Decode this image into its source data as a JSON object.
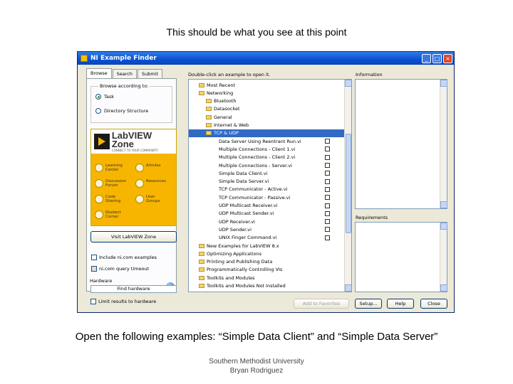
{
  "slide": {
    "title": "This should be what you see at this point",
    "caption": "Open the following examples: “Simple Data Client” and “Simple Data Server”",
    "footer_line1": "Southern Methodist University",
    "footer_line2": "Bryan Rodriguez"
  },
  "window": {
    "title": "NI Example Finder",
    "controls": {
      "minimize": "_",
      "maximize": "□",
      "close": "×"
    }
  },
  "left": {
    "tabs": [
      "Browse",
      "Search",
      "Submit"
    ],
    "browse_label": "Browse according to:",
    "radio_task": "Task",
    "radio_directory": "Directory Structure",
    "zone": {
      "brand": "LabVIEW Zone",
      "tagline": "CONNECT TO YOUR COMMUNITY",
      "items": [
        "Learning Center",
        "Articles",
        "Discussion Forum",
        "Resources",
        "Code Sharing",
        "User Groups",
        "Student Corner"
      ]
    },
    "visit_button": "Visit LabVIEW Zone",
    "include_examples": "Include ni.com examples",
    "query_timeout": "ni.com query timeout",
    "hardware_label": "Hardware",
    "find_hardware": "Find hardware",
    "limit_results": "Limit results to hardware"
  },
  "middle": {
    "label": "Double-click an example to open it.",
    "rows": [
      {
        "text": "Most Recent",
        "indent": 1,
        "icon": "folder"
      },
      {
        "text": "Networking",
        "indent": 1,
        "icon": "folder"
      },
      {
        "text": "Bluetooth",
        "indent": 2,
        "icon": "folder"
      },
      {
        "text": "Datasocket",
        "indent": 2,
        "icon": "folder"
      },
      {
        "text": "General",
        "indent": 2,
        "icon": "folder"
      },
      {
        "text": "Internet & Web",
        "indent": 2,
        "icon": "folder"
      },
      {
        "text": "TCP & UDP",
        "indent": 2,
        "icon": "folder",
        "selected": true
      },
      {
        "text": "Data Server Using Reentrant Run.vi",
        "indent": 3,
        "icon": "vi"
      },
      {
        "text": "Multiple Connections - Client 1.vi",
        "indent": 3,
        "icon": "vi"
      },
      {
        "text": "Multiple Connections - Client 2.vi",
        "indent": 3,
        "icon": "vi"
      },
      {
        "text": "Multiple Connections - Server.vi",
        "indent": 3,
        "icon": "vi"
      },
      {
        "text": "Simple Data Client.vi",
        "indent": 3,
        "icon": "vi"
      },
      {
        "text": "Simple Data Server.vi",
        "indent": 3,
        "icon": "vi"
      },
      {
        "text": "TCP Communicator - Active.vi",
        "indent": 3,
        "icon": "vi"
      },
      {
        "text": "TCP Communicator - Passive.vi",
        "indent": 3,
        "icon": "vi"
      },
      {
        "text": "UDP Multicast Receiver.vi",
        "indent": 3,
        "icon": "vi"
      },
      {
        "text": "UDP Multicast Sender.vi",
        "indent": 3,
        "icon": "vi"
      },
      {
        "text": "UDP Receiver.vi",
        "indent": 3,
        "icon": "vi"
      },
      {
        "text": "UDP Sender.vi",
        "indent": 3,
        "icon": "vi"
      },
      {
        "text": "UNIX Finger Command.vi",
        "indent": 3,
        "icon": "vi"
      },
      {
        "text": "New Examples for LabVIEW 8.x",
        "indent": 1,
        "icon": "folder"
      },
      {
        "text": "Optimizing Applications",
        "indent": 1,
        "icon": "folder"
      },
      {
        "text": "Printing and Publishing Data",
        "indent": 1,
        "icon": "folder"
      },
      {
        "text": "Programmatically Controlling VIs",
        "indent": 1,
        "icon": "folder"
      },
      {
        "text": "Toolkits and Modules",
        "indent": 1,
        "icon": "folder"
      },
      {
        "text": "Toolkits and Modules Not Installed",
        "indent": 1,
        "icon": "folder"
      }
    ]
  },
  "right": {
    "info_label": "Information",
    "requirements_label": "Requirements"
  },
  "buttons": {
    "add_favorites": "Add to Favorites",
    "setup": "Setup...",
    "help": "Help",
    "close": "Close"
  }
}
